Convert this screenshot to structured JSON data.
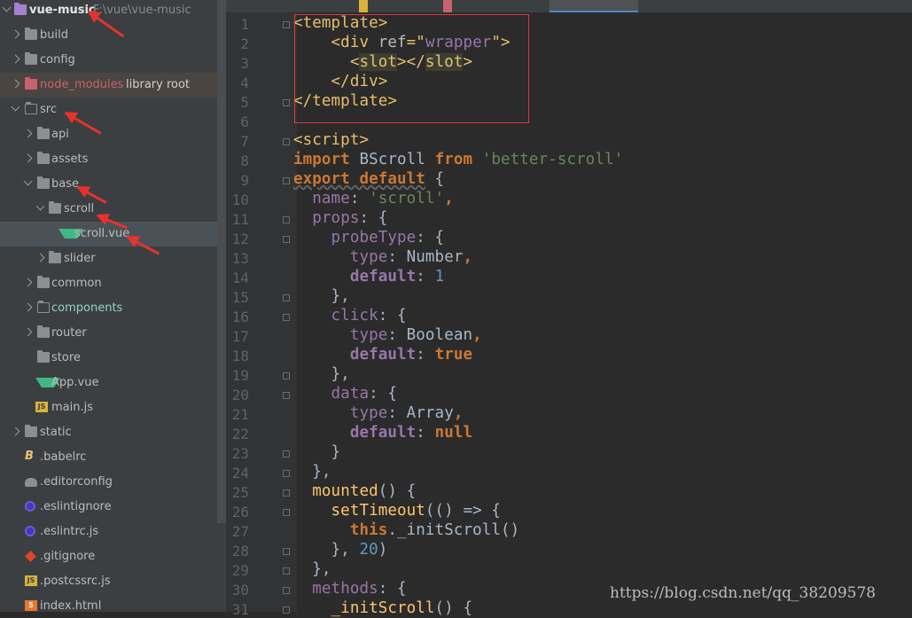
{
  "project_tree": {
    "root": {
      "name": "vue-music",
      "path": "F:\\vue\\vue-music"
    },
    "items": [
      {
        "label": "build",
        "extra": ""
      },
      {
        "label": "config",
        "extra": ""
      },
      {
        "label": "node_modules",
        "extra": "library root"
      },
      {
        "label": "src",
        "extra": ""
      },
      {
        "label": "api",
        "extra": ""
      },
      {
        "label": "assets",
        "extra": ""
      },
      {
        "label": "base",
        "extra": ""
      },
      {
        "label": "scroll",
        "extra": ""
      },
      {
        "label": "scroll.vue",
        "extra": ""
      },
      {
        "label": "slider",
        "extra": ""
      },
      {
        "label": "common",
        "extra": ""
      },
      {
        "label": "components",
        "extra": ""
      },
      {
        "label": "router",
        "extra": ""
      },
      {
        "label": "store",
        "extra": ""
      },
      {
        "label": "App.vue",
        "extra": ""
      },
      {
        "label": "main.js",
        "extra": ""
      },
      {
        "label": "static",
        "extra": ""
      },
      {
        "label": ".babelrc",
        "extra": ""
      },
      {
        "label": ".editorconfig",
        "extra": ""
      },
      {
        "label": ".eslintignore",
        "extra": ""
      },
      {
        "label": ".eslintrc.js",
        "extra": ""
      },
      {
        "label": ".gitignore",
        "extra": ""
      },
      {
        "label": ".postcssrc.js",
        "extra": ""
      },
      {
        "label": "index.html",
        "extra": ""
      }
    ],
    "icon_labels": {
      "js": "JS",
      "html": "5",
      "babel": "B"
    }
  },
  "editor": {
    "line_numbers": [
      "1",
      "2",
      "3",
      "4",
      "5",
      "6",
      "7",
      "8",
      "9",
      "10",
      "11",
      "12",
      "13",
      "14",
      "15",
      "16",
      "17",
      "18",
      "19",
      "20",
      "21",
      "22",
      "23",
      "24",
      "25",
      "26",
      "27",
      "28",
      "29",
      "30",
      "31"
    ],
    "code": {
      "l1": [
        "<template>"
      ],
      "l2": [
        "    <div ",
        "ref",
        "=\"",
        "wrapper",
        "\">"
      ],
      "l3": [
        "      <",
        "slot",
        "></",
        "slot",
        ">"
      ],
      "l4": [
        "    </div>"
      ],
      "l5": [
        "</template>"
      ],
      "l7": [
        "<script>"
      ],
      "l8": [
        "import",
        " BScroll ",
        "from",
        " ",
        "'better-scroll'"
      ],
      "l9": [
        "export default",
        " {"
      ],
      "l10": [
        "  ",
        "name",
        ": ",
        "'scroll'",
        ","
      ],
      "l11": [
        "  ",
        "props",
        ": {"
      ],
      "l12": [
        "    ",
        "probeType",
        ": {"
      ],
      "l13": [
        "      ",
        "type",
        ": Number",
        ","
      ],
      "l14": [
        "      ",
        "default",
        ": ",
        "1"
      ],
      "l15": [
        "    },"
      ],
      "l16": [
        "    ",
        "click",
        ": {"
      ],
      "l17": [
        "      ",
        "type",
        ": Boolean",
        ","
      ],
      "l18": [
        "      ",
        "default",
        ": ",
        "true"
      ],
      "l19": [
        "    },"
      ],
      "l20": [
        "    ",
        "data",
        ": {"
      ],
      "l21": [
        "      ",
        "type",
        ": Array",
        ","
      ],
      "l22": [
        "      ",
        "default",
        ": ",
        "null"
      ],
      "l23": [
        "    }"
      ],
      "l24": [
        "  },"
      ],
      "l25": [
        "  ",
        "mounted",
        "() {"
      ],
      "l26": [
        "    ",
        "setTimeout",
        "(() => {"
      ],
      "l27": [
        "      ",
        "this",
        ".",
        "_initScroll",
        "()"
      ],
      "l28": [
        "    }, ",
        "20",
        ")"
      ],
      "l29": [
        "  },"
      ],
      "l30": [
        "  ",
        "methods",
        ": {"
      ],
      "l31": [
        "    ",
        "_initScroll",
        "() {"
      ]
    }
  },
  "watermark": "https://blog.csdn.net/qq_38209578",
  "colors": {
    "annotation_arrow": "#e8322d",
    "highlight_box": "#e0393e",
    "vue": "#41b883"
  }
}
